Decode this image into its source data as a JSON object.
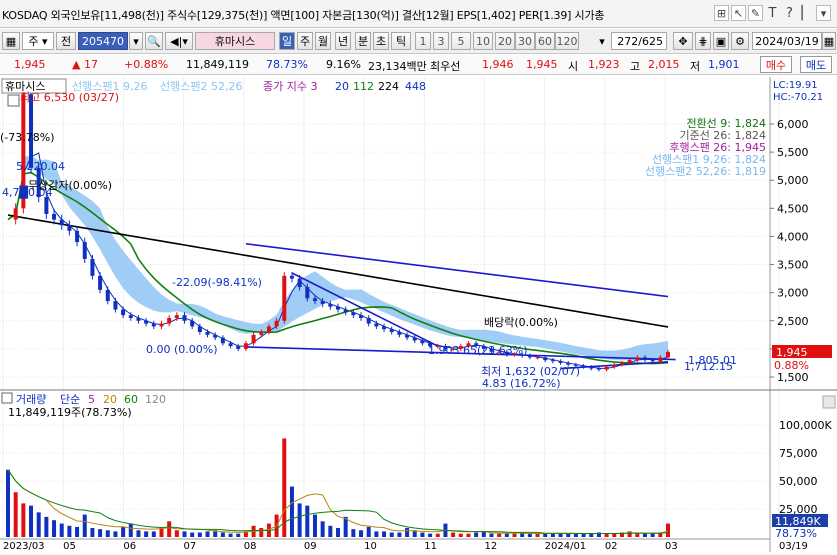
{
  "title_bar": {
    "text": "KOSDAQ 외국인보유[11,498(천)] 주식수[129,375(천)] 액면[100] 자본금[130(억)] 결산[12월] EPS[1,402] PER[1.39] 시가총",
    "icons": [
      "⊞",
      "↖",
      "✎",
      "T",
      "?",
      "▏",
      "▾"
    ]
  },
  "toolbar": {
    "period": "주",
    "prev": "전",
    "code": "205470",
    "stock_name": "휴마시스",
    "period_tabs": [
      "일",
      "주",
      "월",
      "년",
      "분",
      "초",
      "틱"
    ],
    "intervals": [
      "1",
      "3",
      "5",
      "10",
      "20",
      "30",
      "60",
      "120"
    ],
    "page_count": "272/625",
    "date": "2024/03/19"
  },
  "quote": {
    "price": "1,945",
    "change": "▲  17",
    "change_pct": "+0.88%",
    "volume": "11,849,119",
    "volume_ratio": "78.73%",
    "turnover": "9.16%",
    "amount": "23,134백만",
    "best_label": "최우선",
    "best_ask": "1,946",
    "best_bid": "1,945",
    "open_label": "시",
    "open": "1,923",
    "high_label": "고",
    "high": "2,015",
    "low_label": "저",
    "low": "1,901",
    "buy": "매수",
    "sell": "매도"
  },
  "colors": {
    "up": "#e01010",
    "down": "#1030c0",
    "cloud": "#8fc4f4",
    "ma_long": "#000000",
    "ma_mid": "#108010",
    "trend": "#1a1ad0"
  },
  "chart_data": {
    "type": "candlestick",
    "legend_top": {
      "name": "휴마시스",
      "span1": "선행스팬1 9,26",
      "span2": "선행스팬2 52,26",
      "close_label": "종가 지수 3",
      "ma20": "20",
      "ma112": "112",
      "ma224": "224",
      "ma448": "448"
    },
    "lc": "LC:19.91",
    "hc": "HC:-70.21",
    "ichimoku_legend": [
      {
        "text": "전환선 9: 1,824",
        "color": "#107010"
      },
      {
        "text": "기준선 26: 1,824",
        "color": "#555555"
      },
      {
        "text": "후행스팬 26: 1,945",
        "color": "#a0209e"
      },
      {
        "text": "선행스팬1 9,26: 1,824",
        "color": "#7ab8ee"
      },
      {
        "text": "선행스팬2 52,26: 1,819",
        "color": "#7ab8ee"
      }
    ],
    "price_axis": {
      "min": 1500,
      "max": 6000,
      "ticks": [
        "6,000",
        "5,500",
        "5,000",
        "4,500",
        "4,000",
        "3,500",
        "3,000",
        "2,500",
        "2,000",
        "1,500"
      ],
      "current": "1,945",
      "current_pct": "0.88%"
    },
    "annotations": {
      "max": "최고 6,530 (03/27)",
      "left_pct": "(-73.78%)",
      "level_5220": "5,220.04",
      "left_level": "4,7█0.04",
      "nosell": "무상감자(0.00%)",
      "mid_pct": "-22.09(-98.41%)",
      "zero_level": "0.00 (0.00%)",
      "dividend": "배당락(0.00%)",
      "cluster": "1.903.65(23.63%)",
      "min": "최저 1,632 (02/07)",
      "bottom_pct": "4.83 (16.72%)",
      "right_high": "1,805.01",
      "right_low": "1,712.15"
    },
    "volume_legend": {
      "label": "거래량",
      "simple": "단순",
      "ma5": "5",
      "ma20": "20",
      "ma60": "60",
      "ma120": "120",
      "total": "11,849,119주(78.73%)"
    },
    "volume_axis": {
      "min": 0,
      "max": 125000,
      "ticks": [
        "100,000K",
        "75,000",
        "50,000",
        "25,000"
      ],
      "current": "11,849K",
      "current_pct": "78.73%"
    },
    "x_labels": [
      "2023/03",
      "05",
      "06",
      "07",
      "08",
      "09",
      "10",
      "11",
      "12",
      "2024/01",
      "02",
      "03",
      "03/19"
    ],
    "price_series": [
      4300,
      4500,
      6530,
      5220,
      4700,
      4400,
      4300,
      4200,
      4100,
      3900,
      3600,
      3300,
      3050,
      2850,
      2700,
      2600,
      2550,
      2500,
      2450,
      2400,
      2450,
      2550,
      2600,
      2500,
      2400,
      2300,
      2250,
      2200,
      2100,
      2050,
      2000,
      2100,
      2250,
      2300,
      2400,
      2500,
      3300,
      3250,
      3100,
      2900,
      2850,
      2800,
      2750,
      2700,
      2650,
      2600,
      2550,
      2450,
      2400,
      2350,
      2300,
      2250,
      2200,
      2150,
      2100,
      2050,
      2050,
      2000,
      2000,
      2050,
      2100,
      2050,
      2000,
      1950,
      1950,
      1900,
      1900,
      1880,
      1850,
      1850,
      1800,
      1780,
      1750,
      1720,
      1700,
      1680,
      1650,
      1632,
      1680,
      1720,
      1750,
      1800,
      1850,
      1800,
      1780,
      1850,
      1945
    ],
    "volume_series": [
      60,
      40,
      30,
      28,
      22,
      18,
      15,
      12,
      10,
      9,
      20,
      8,
      7,
      6,
      5,
      9,
      12,
      6,
      5,
      5,
      8,
      14,
      6,
      5,
      4,
      4,
      5,
      6,
      4,
      3,
      3,
      5,
      10,
      8,
      12,
      20,
      88,
      45,
      30,
      28,
      20,
      14,
      10,
      8,
      18,
      7,
      6,
      9,
      5,
      5,
      4,
      4,
      8,
      6,
      4,
      3,
      3,
      12,
      4,
      3,
      3,
      4,
      5,
      3,
      3,
      3,
      3,
      4,
      3,
      3,
      3,
      3,
      3,
      3,
      3,
      3,
      3,
      4,
      3,
      3,
      4,
      5,
      3,
      3,
      3,
      4,
      12
    ]
  }
}
